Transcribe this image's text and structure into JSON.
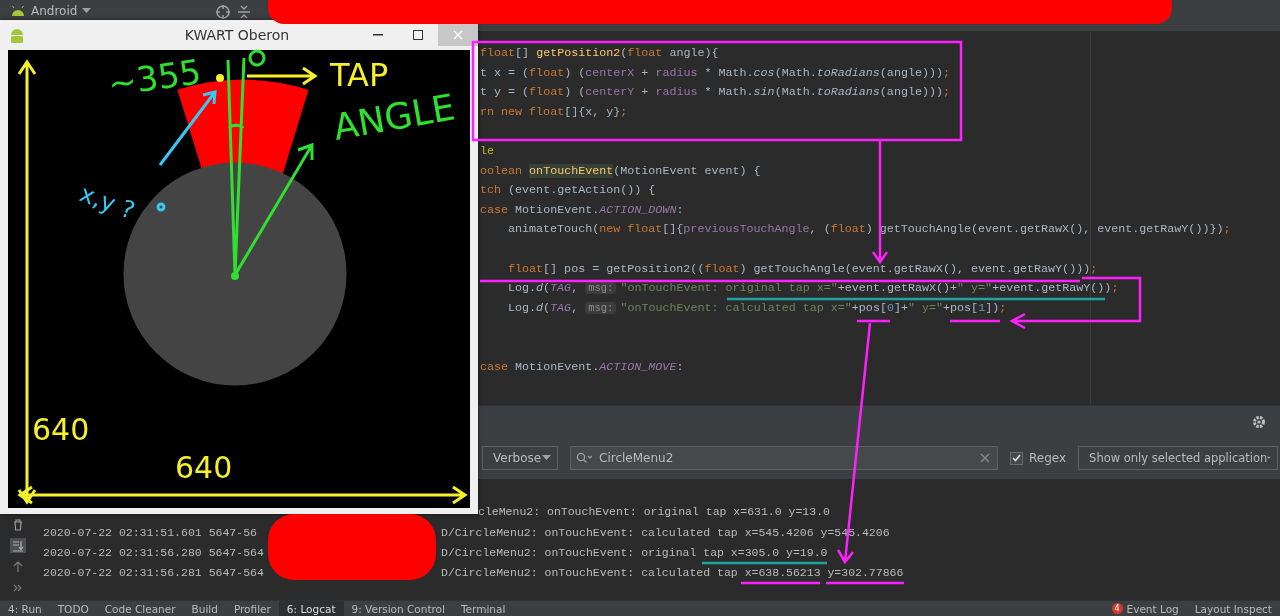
{
  "top_bar": {
    "project_view": "Android"
  },
  "emulator": {
    "title": "KWART Oberon"
  },
  "editor": {
    "lines": [
      {
        "kind": "code",
        "indent": false,
        "tokens": [
          {
            "text": "float",
            "kind": "kw"
          },
          {
            "text": "[] ",
            "kind": "plain"
          },
          {
            "text": "getPosition2",
            "kind": "fn"
          },
          {
            "text": "(",
            "kind": "plain"
          },
          {
            "text": "float",
            "kind": "kw"
          },
          {
            "text": " angle){",
            "kind": "plain"
          }
        ]
      },
      {
        "kind": "code",
        "indent": false,
        "tokens": [
          {
            "text": "t x = (",
            "kind": "plain"
          },
          {
            "text": "float",
            "kind": "kw"
          },
          {
            "text": ") (",
            "kind": "plain"
          },
          {
            "text": "centerX",
            "kind": "field"
          },
          {
            "text": " + ",
            "kind": "plain"
          },
          {
            "text": "radius",
            "kind": "field"
          },
          {
            "text": " * Math.",
            "kind": "plain"
          },
          {
            "text": "cos",
            "kind": "italic"
          },
          {
            "text": "(Math.",
            "kind": "plain"
          },
          {
            "text": "toRadians",
            "kind": "italic"
          },
          {
            "text": "(angle)))",
            "kind": "plain"
          },
          {
            "text": ";",
            "kind": "kw"
          }
        ]
      },
      {
        "kind": "code",
        "indent": false,
        "tokens": [
          {
            "text": "t y = (",
            "kind": "plain"
          },
          {
            "text": "float",
            "kind": "kw"
          },
          {
            "text": ") (",
            "kind": "plain"
          },
          {
            "text": "centerY",
            "kind": "field"
          },
          {
            "text": " + ",
            "kind": "plain"
          },
          {
            "text": "radius",
            "kind": "field"
          },
          {
            "text": " * Math.",
            "kind": "plain"
          },
          {
            "text": "sin",
            "kind": "italic"
          },
          {
            "text": "(Math.",
            "kind": "plain"
          },
          {
            "text": "toRadians",
            "kind": "italic"
          },
          {
            "text": "(angle)))",
            "kind": "plain"
          },
          {
            "text": ";",
            "kind": "kw"
          }
        ]
      },
      {
        "kind": "code",
        "indent": false,
        "tokens": [
          {
            "text": "rn new float",
            "kind": "kw"
          },
          {
            "text": "[]{x, y}",
            "kind": "plain"
          },
          {
            "text": ";",
            "kind": "kw"
          }
        ]
      },
      {
        "kind": "blank"
      },
      {
        "kind": "code",
        "indent": false,
        "tokens": [
          {
            "text": "le",
            "kind": "annotation"
          }
        ]
      },
      {
        "kind": "code",
        "indent": false,
        "tokens": [
          {
            "text": "oolean ",
            "kind": "kw"
          },
          {
            "text": "onTouchEvent",
            "kind": "highlight"
          },
          {
            "text": "(MotionEvent event) {",
            "kind": "plain"
          }
        ]
      },
      {
        "kind": "code",
        "indent": false,
        "tokens": [
          {
            "text": "tch ",
            "kind": "kw"
          },
          {
            "text": "(event.getAction()) {",
            "kind": "plain"
          }
        ]
      },
      {
        "kind": "code",
        "indent": false,
        "tokens": [
          {
            "text": "case ",
            "kind": "kw"
          },
          {
            "text": "MotionEvent.",
            "kind": "plain"
          },
          {
            "text": "ACTION_DOWN",
            "kind": "constant"
          },
          {
            "text": ":",
            "kind": "plain"
          }
        ]
      },
      {
        "kind": "code",
        "indent": true,
        "tokens": [
          {
            "text": "animateTouch(",
            "kind": "plain"
          },
          {
            "text": "new float",
            "kind": "kw"
          },
          {
            "text": "[]{",
            "kind": "plain"
          },
          {
            "text": "previousTouchAngle",
            "kind": "field"
          },
          {
            "text": ", (",
            "kind": "plain"
          },
          {
            "text": "float",
            "kind": "kw"
          },
          {
            "text": ") getTouchAngle(event.getRawX(), event.getRawY())})",
            "kind": "plain"
          },
          {
            "text": ";",
            "kind": "kw"
          }
        ]
      },
      {
        "kind": "blank"
      },
      {
        "kind": "code",
        "indent": true,
        "tokens": [
          {
            "text": "float",
            "kind": "kw"
          },
          {
            "text": "[] pos = getPosition2((",
            "kind": "plain"
          },
          {
            "text": "float",
            "kind": "kw"
          },
          {
            "text": ") getTouchAngle(event.getRawX(), event.getRawY()))",
            "kind": "plain"
          },
          {
            "text": ";",
            "kind": "kw"
          }
        ]
      },
      {
        "kind": "code",
        "indent": true,
        "tokens": [
          {
            "text": "Log.",
            "kind": "plain"
          },
          {
            "text": "d",
            "kind": "italic"
          },
          {
            "text": "(",
            "kind": "plain"
          },
          {
            "text": "TAG",
            "kind": "constant"
          },
          {
            "text": ", ",
            "kind": "plain"
          },
          {
            "text": "msg:",
            "kind": "hint"
          },
          {
            "text": "\"onTouchEvent: original tap x=\"",
            "kind": "string"
          },
          {
            "text": "+event.getRawX()+",
            "kind": "plain"
          },
          {
            "text": "\" y=\"",
            "kind": "string"
          },
          {
            "text": "+event.getRawY())",
            "kind": "plain"
          },
          {
            "text": ";",
            "kind": "kw"
          }
        ]
      },
      {
        "kind": "code",
        "indent": true,
        "tokens": [
          {
            "text": "Log.",
            "kind": "plain"
          },
          {
            "text": "d",
            "kind": "italic"
          },
          {
            "text": "(",
            "kind": "plain"
          },
          {
            "text": "TAG",
            "kind": "constant"
          },
          {
            "text": ", ",
            "kind": "plain"
          },
          {
            "text": "msg:",
            "kind": "hint"
          },
          {
            "text": "\"onTouchEvent: calculated tap x=\"",
            "kind": "string"
          },
          {
            "text": "+pos[",
            "kind": "plain"
          },
          {
            "text": "0",
            "kind": "number"
          },
          {
            "text": "]+",
            "kind": "plain"
          },
          {
            "text": "\" y=\"",
            "kind": "string"
          },
          {
            "text": "+pos[",
            "kind": "plain"
          },
          {
            "text": "1",
            "kind": "number"
          },
          {
            "text": "])",
            "kind": "plain"
          },
          {
            "text": ";",
            "kind": "kw"
          }
        ]
      },
      {
        "kind": "blank"
      },
      {
        "kind": "blank"
      },
      {
        "kind": "code",
        "indent": false,
        "tokens": [
          {
            "text": "case ",
            "kind": "kw"
          },
          {
            "text": "MotionEvent.",
            "kind": "plain"
          },
          {
            "text": "ACTION_MOVE",
            "kind": "constant"
          },
          {
            "text": ":",
            "kind": "plain"
          }
        ]
      }
    ]
  },
  "logcat": {
    "level": "Verbose",
    "search": "CircleMenu2",
    "regex": {
      "label": "Regex",
      "checked": true
    },
    "filter": "Show only selected application",
    "lines": [
      {
        "message": "cleMenu2: onTouchEvent: original tap x=631.0 y=13.0"
      },
      {
        "prefix": "2020-07-22 02:31:51.601 5647-56",
        "message": "D/CircleMenu2: onTouchEvent: calculated tap x=545.4206 y=545.4206"
      },
      {
        "prefix": "2020-07-22 02:31:56.280 5647-564",
        "message": "D/CircleMenu2: onTouchEvent: original tap x=305.0 y=19.0"
      },
      {
        "prefix": "2020-07-22 02:31:56.281 5647-564",
        "message": "D/CircleMenu2: onTouchEvent: calculated tap x=638.56213 y=302.77866"
      }
    ]
  },
  "tool_tabs": [
    {
      "label": "4: Run",
      "selected": false
    },
    {
      "label": "TODO",
      "selected": false
    },
    {
      "label": "Code Cleaner",
      "selected": false
    },
    {
      "label": "Build",
      "selected": false
    },
    {
      "label": "Profiler",
      "selected": false
    },
    {
      "label": "6: Logcat",
      "selected": true
    },
    {
      "label": "9: Version Control",
      "selected": false
    },
    {
      "label": "Terminal",
      "selected": false
    }
  ],
  "right_tabs": [
    {
      "label": "Event Log",
      "badge": "4"
    },
    {
      "label": "Layout Inspect"
    }
  ],
  "annotations": [
    {
      "text": "~355",
      "color": "#2fe02f"
    },
    {
      "text": "TAP",
      "color": "#f5f02a"
    },
    {
      "text": "ANGLE",
      "color": "#2fe02f"
    },
    {
      "text": "x,y ?",
      "color": "#35c8f0"
    },
    {
      "text": "640",
      "color": "#f5f02a"
    },
    {
      "text": "640",
      "color": "#f5f02a"
    }
  ]
}
